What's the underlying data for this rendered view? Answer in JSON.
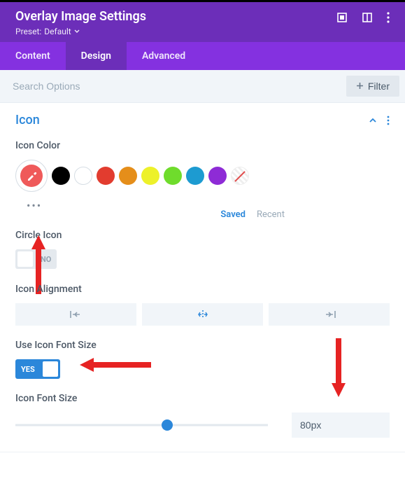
{
  "header": {
    "title": "Overlay Image Settings",
    "preset_prefix": "Preset:",
    "preset_value": "Default"
  },
  "tabs": {
    "content": "Content",
    "design": "Design",
    "advanced": "Advanced",
    "active": "design"
  },
  "search": {
    "placeholder": "Search Options",
    "filter_label": "Filter"
  },
  "section": {
    "title": "Icon"
  },
  "icon_color": {
    "label": "Icon Color",
    "saved_label": "Saved",
    "recent_label": "Recent",
    "swatches": [
      "#000000",
      "outline",
      "#e23c2f",
      "#e58e1a",
      "#edf12a",
      "#6fdc2c",
      "#1d9bd1",
      "#8e2bd6",
      "transparent"
    ]
  },
  "circle_icon": {
    "label": "Circle Icon",
    "value": false,
    "off_text": "NO"
  },
  "icon_alignment": {
    "label": "Icon Alignment",
    "active": "center"
  },
  "use_icon_font_size": {
    "label": "Use Icon Font Size",
    "value": true,
    "on_text": "YES"
  },
  "icon_font_size": {
    "label": "Icon Font Size",
    "value": "80px",
    "slider_percent": 60
  }
}
